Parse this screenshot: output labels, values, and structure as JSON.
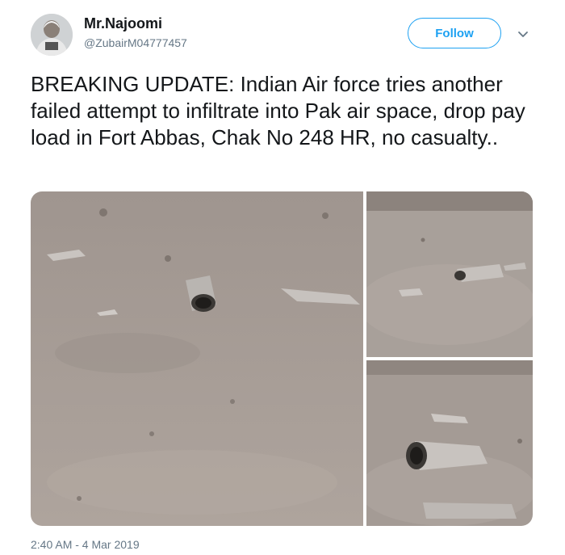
{
  "user": {
    "name": "Mr.Najoomi",
    "handle": "@ZubairM04777457",
    "avatar_icon": "user-avatar-icon"
  },
  "actions": {
    "follow_label": "Follow",
    "menu_icon": "chevron-down-icon"
  },
  "tweet": {
    "text": "BREAKING UPDATE: Indian Air force tries another failed attempt to infiltrate into Pak air space, drop pay load in Fort Abbas, Chak No 248 HR, no casualty..",
    "timestamp": "2:40 AM - 4 Mar 2019"
  },
  "colors": {
    "accent": "#1da1f2",
    "text_primary": "#14171a",
    "text_secondary": "#657786",
    "ground": "#a39892"
  }
}
